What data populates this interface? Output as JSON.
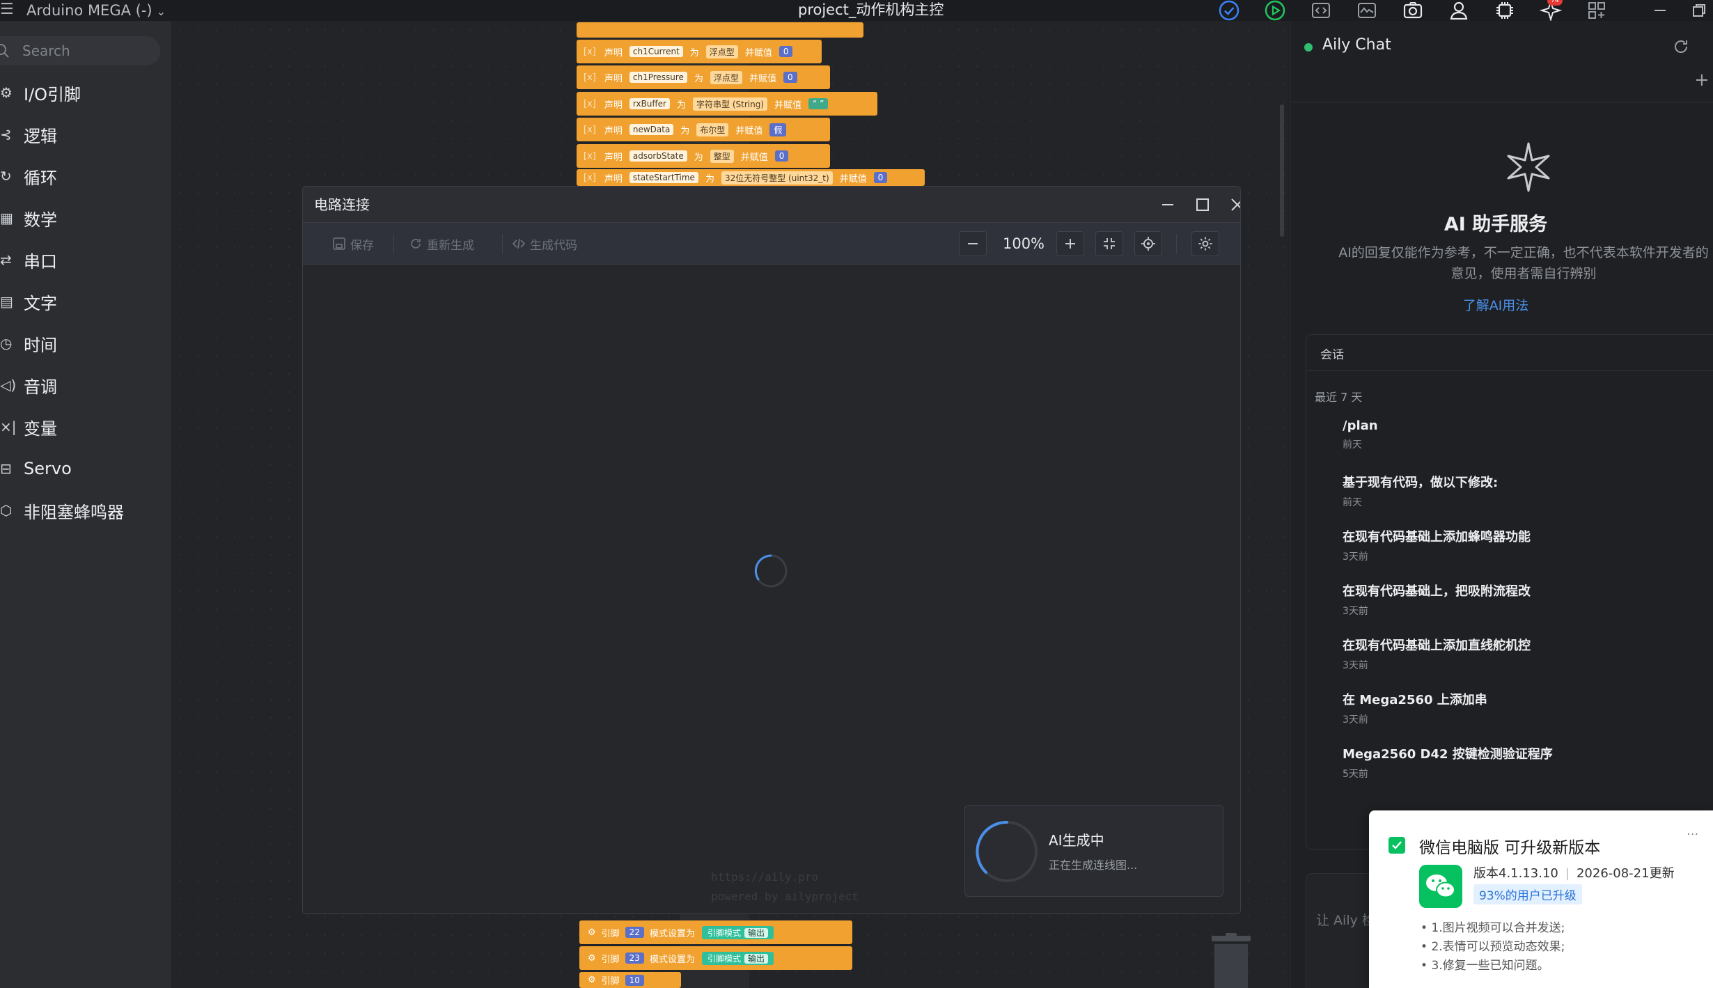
{
  "titlebar": {
    "menu_glyph": "☰",
    "board": "Arduino MEGA (-)",
    "title": "project_动作机构主控",
    "badge": "74"
  },
  "sidebar": {
    "search_placeholder": "Search",
    "categories": [
      {
        "icon": "io-icon",
        "label": "I/O引脚"
      },
      {
        "icon": "logic-icon",
        "label": "逻辑"
      },
      {
        "icon": "loop-icon",
        "label": "循环"
      },
      {
        "icon": "math-icon",
        "label": "数学"
      },
      {
        "icon": "serial-icon",
        "label": "串口"
      },
      {
        "icon": "text-icon",
        "label": "文字"
      },
      {
        "icon": "clock-icon",
        "label": "时间"
      },
      {
        "icon": "tone-icon",
        "label": "音调"
      },
      {
        "icon": "variable-icon",
        "label": "变量"
      },
      {
        "icon": "servo-icon",
        "label": "Servo"
      },
      {
        "icon": "buzzer-icon",
        "label": "非阻塞蜂鸣器"
      }
    ]
  },
  "workspace": {
    "declare_blocks": [
      {
        "kw": "声明",
        "name": "ch1Current",
        "type": "浮点型",
        "assign": "并赋值",
        "value": "0"
      },
      {
        "kw": "声明",
        "name": "ch1Pressure",
        "type": "浮点型",
        "assign": "并赋值",
        "value": "0"
      },
      {
        "kw": "声明",
        "name": "rxBuffer",
        "type": "字符串型 (String)",
        "assign": "并赋值",
        "value": "“ ”"
      },
      {
        "kw": "声明",
        "name": "newData",
        "type": "布尔型",
        "assign": "并赋值",
        "value": "假"
      },
      {
        "kw": "声明",
        "name": "adsorbState",
        "type": "整型",
        "assign": "并赋值",
        "value": "0"
      },
      {
        "kw": "声明",
        "name": "stateStartTime",
        "type": "32位无符号整型 (uint32_t)",
        "assign": "并赋值",
        "value": "0"
      }
    ],
    "as_word": "为",
    "pin_blocks": [
      {
        "kw": "引脚",
        "pin": "22",
        "set": "模式设置为",
        "mode": "引脚模式",
        "out": "输出"
      },
      {
        "kw": "引脚",
        "pin": "23",
        "set": "模式设置为",
        "mode": "引脚模式",
        "out": "输出"
      },
      {
        "kw": "引脚",
        "pin": "10",
        "set": "",
        "mode": "",
        "out": ""
      }
    ]
  },
  "dialog": {
    "title": "电路连接",
    "toolbar": {
      "save": "保存",
      "regenerate": "重新生成",
      "gen_code": "生成代码"
    },
    "zoom": "100%",
    "ai_card": {
      "title": "AI生成中",
      "subtitle": "正在生成连线图..."
    },
    "watermark": [
      "https://aily.pro",
      "powered by ailyproject"
    ]
  },
  "right_panel": {
    "title": "Aily Chat",
    "heading": "AI 助手服务",
    "description": "AI的回复仅能作为参考，不一定正确，也不代表本软件开发者的意见，使用者需自行辨别",
    "link": "了解AI用法",
    "session_tab": "会话",
    "group_label": "最近 7 天",
    "sessions": [
      {
        "title": "/plan",
        "date": "前天"
      },
      {
        "title": "基于现有代码，做以下修改:",
        "date": "前天"
      },
      {
        "title": "在现有代码基础上添加蜂鸣器功能",
        "date": "3天前"
      },
      {
        "title": "在现有代码基础上，把吸附流程改",
        "date": "3天前"
      },
      {
        "title": "在现有代码基础上添加直线舵机控",
        "date": "3天前"
      },
      {
        "title": "在 Mega2560 上添加串",
        "date": "3天前"
      },
      {
        "title": "Mega2560 D42 按键检测验证程序",
        "date": "5天前"
      }
    ],
    "input_placeholder": "让 Aily 检"
  },
  "toast": {
    "title": "微信电脑版 可升级新版本",
    "more": "···",
    "version": "版本4.1.13.10",
    "date": "2026-08-21更新",
    "tag": "93%的用户已升级",
    "notes": [
      "1.图片视频可以合并发送;",
      "2.表情可以预览动态效果;",
      "3.修复一些已知问题。"
    ]
  },
  "colors": {
    "block_orange": "#f0a12f",
    "value_blue": "#5b6fc9",
    "mode_teal": "#2fbf9a",
    "link_blue": "#4a8fe8",
    "status_green": "#2fbf71",
    "wechat_green": "#07c160"
  }
}
